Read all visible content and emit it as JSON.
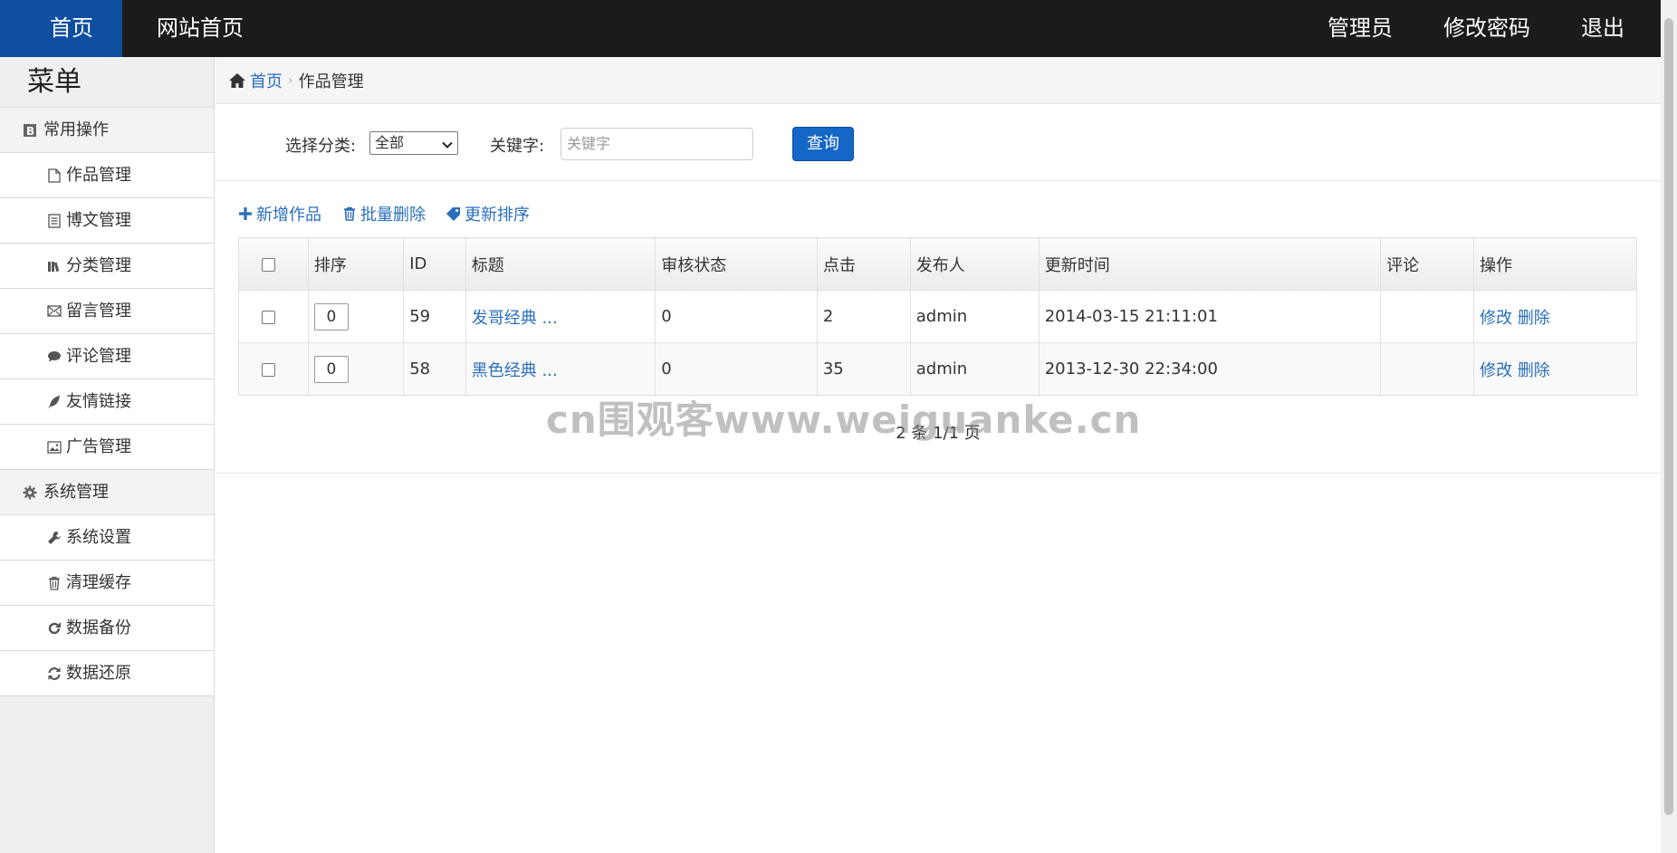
{
  "topnav": {
    "home": "首页",
    "site_home": "网站首页",
    "admin": "管理员",
    "change_password": "修改密码",
    "logout": "退出"
  },
  "sidebar": {
    "title": "菜单",
    "groups": [
      {
        "label": "常用操作",
        "icon": "bold-book-icon",
        "items": [
          {
            "label": "作品管理",
            "icon": "file-icon"
          },
          {
            "label": "博文管理",
            "icon": "list-doc-icon"
          },
          {
            "label": "分类管理",
            "icon": "books-icon"
          },
          {
            "label": "留言管理",
            "icon": "envelope-icon"
          },
          {
            "label": "评论管理",
            "icon": "comment-icon"
          },
          {
            "label": "友情链接",
            "icon": "feather-icon"
          },
          {
            "label": "广告管理",
            "icon": "picture-icon"
          }
        ]
      },
      {
        "label": "系统管理",
        "icon": "gear-icon",
        "items": [
          {
            "label": "系统设置",
            "icon": "wrench-icon"
          },
          {
            "label": "清理缓存",
            "icon": "trash-icon"
          },
          {
            "label": "数据备份",
            "icon": "refresh-icon"
          },
          {
            "label": "数据还原",
            "icon": "sync-icon"
          }
        ]
      }
    ]
  },
  "breadcrumb": {
    "home": "首页",
    "current": "作品管理"
  },
  "search": {
    "category_label": "选择分类:",
    "category_value": "全部",
    "keyword_label": "关键字:",
    "keyword_placeholder": "关键字",
    "query_button": "查询"
  },
  "toolbar": {
    "add": "新增作品",
    "batch_delete": "批量删除",
    "update_sort": "更新排序"
  },
  "table": {
    "headers": [
      "排序",
      "ID",
      "标题",
      "审核状态",
      "点击",
      "发布人",
      "更新时间",
      "评论",
      "操作"
    ],
    "rows": [
      {
        "sort": "0",
        "id": "59",
        "title": "发哥经典 ...",
        "status": "0",
        "clicks": "2",
        "author": "admin",
        "updated": "2014-03-15 21:11:01",
        "comments": "",
        "edit": "修改",
        "delete": "删除"
      },
      {
        "sort": "0",
        "id": "58",
        "title": "黑色经典 ...",
        "status": "0",
        "clicks": "35",
        "author": "admin",
        "updated": "2013-12-30 22:34:00",
        "comments": "",
        "edit": "修改",
        "delete": "删除"
      }
    ]
  },
  "pager": {
    "text": "2 条  1/1 页"
  },
  "watermark": "cn围观客www.weiguanke.cn"
}
